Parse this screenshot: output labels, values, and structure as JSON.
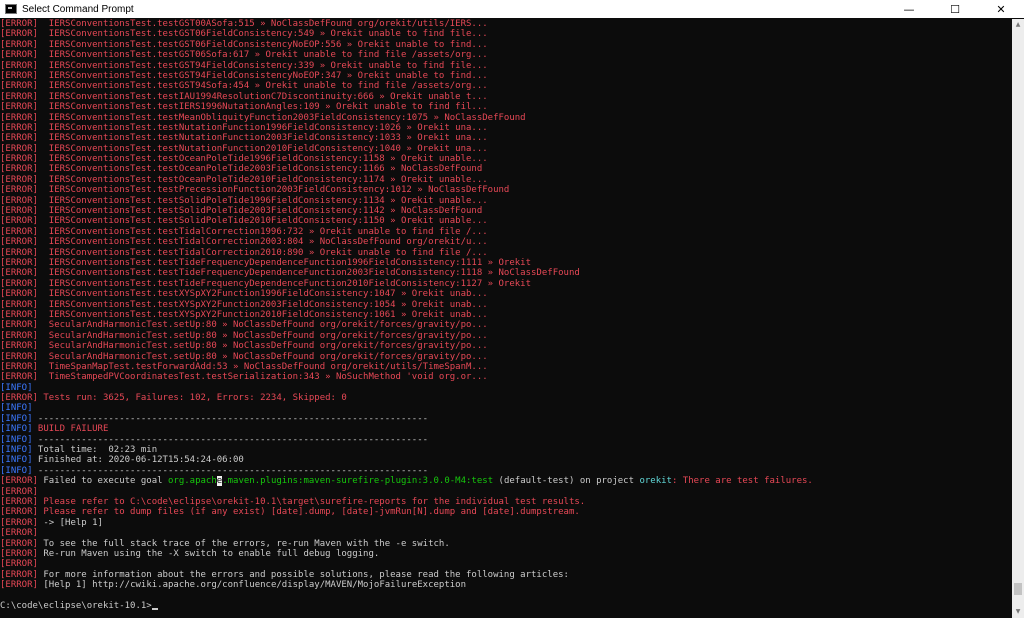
{
  "window": {
    "title": "Select Command Prompt",
    "controls": {
      "minimize": "—",
      "maximize": "☐",
      "close": "✕"
    }
  },
  "colors": {
    "background": "#0c0c0c",
    "error": "#e74856",
    "info": "#3b78ff",
    "green": "#16c60c",
    "cyan": "#61d6d6",
    "text": "#cccccc"
  },
  "terminal": {
    "error_tag": "[ERROR]",
    "info_tag": "[INFO]",
    "test_errors": [
      "  IERSConventionsTest.testGST00ASofa:515 » NoClassDefFound org/orekit/utils/IERS...",
      "  IERSConventionsTest.testGST06FieldConsistency:549 » Orekit unable to find file...",
      "  IERSConventionsTest.testGST06FieldConsistencyNoEOP:556 » Orekit unable to find...",
      "  IERSConventionsTest.testGST06Sofa:617 » Orekit unable to find file /assets/org...",
      "  IERSConventionsTest.testGST94FieldConsistency:339 » Orekit unable to find file...",
      "  IERSConventionsTest.testGST94FieldConsistencyNoEOP:347 » Orekit unable to find...",
      "  IERSConventionsTest.testGST94Sofa:454 » Orekit unable to find file /assets/org...",
      "  IERSConventionsTest.testIAU1994ResolutionC7Discontinuity:666 » Orekit unable t...",
      "  IERSConventionsTest.testIERS1996NutationAngles:109 » Orekit unable to find fil...",
      "  IERSConventionsTest.testMeanObliquityFunction2003FieldConsistency:1075 » NoClassDefFound",
      "  IERSConventionsTest.testNutationFunction1996FieldConsistency:1026 » Orekit una...",
      "  IERSConventionsTest.testNutationFunction2003FieldConsistency:1033 » Orekit una...",
      "  IERSConventionsTest.testNutationFunction2010FieldConsistency:1040 » Orekit una...",
      "  IERSConventionsTest.testOceanPoleTide1996FieldConsistency:1158 » Orekit unable...",
      "  IERSConventionsTest.testOceanPoleTide2003FieldConsistency:1166 » NoClassDefFound",
      "  IERSConventionsTest.testOceanPoleTide2010FieldConsistency:1174 » Orekit unable...",
      "  IERSConventionsTest.testPrecessionFunction2003FieldConsistency:1012 » NoClassDefFound",
      "  IERSConventionsTest.testSolidPoleTide1996FieldConsistency:1134 » Orekit unable...",
      "  IERSConventionsTest.testSolidPoleTide2003FieldConsistency:1142 » NoClassDefFound",
      "  IERSConventionsTest.testSolidPoleTide2010FieldConsistency:1150 » Orekit unable...",
      "  IERSConventionsTest.testTidalCorrection1996:732 » Orekit unable to find file /...",
      "  IERSConventionsTest.testTidalCorrection2003:804 » NoClassDefFound org/orekit/u...",
      "  IERSConventionsTest.testTidalCorrection2010:890 » Orekit unable to find file /...",
      "  IERSConventionsTest.testTideFrequencyDependenceFunction1996FieldConsistency:1111 » Orekit",
      "  IERSConventionsTest.testTideFrequencyDependenceFunction2003FieldConsistency:1118 » NoClassDefFound",
      "  IERSConventionsTest.testTideFrequencyDependenceFunction2010FieldConsistency:1127 » Orekit",
      "  IERSConventionsTest.testXYSpXY2Function1996FieldConsistency:1047 » Orekit unab...",
      "  IERSConventionsTest.testXYSpXY2Function2003FieldConsistency:1054 » Orekit unab...",
      "  IERSConventionsTest.testXYSpXY2Function2010FieldConsistency:1061 » Orekit unab...",
      "  SecularAndHarmonicTest.setUp:80 » NoClassDefFound org/orekit/forces/gravity/po...",
      "  SecularAndHarmonicTest.setUp:80 » NoClassDefFound org/orekit/forces/gravity/po...",
      "  SecularAndHarmonicTest.setUp:80 » NoClassDefFound org/orekit/forces/gravity/po...",
      "  SecularAndHarmonicTest.setUp:80 » NoClassDefFound org/orekit/forces/gravity/po...",
      "  TimeSpanMapTest.testForwardAdd:53 » NoClassDefFound org/orekit/utils/TimeSpanM...",
      "  TimeStampedPVCoordinatesTest.testSerialization:343 » NoSuchMethod 'void org.or..."
    ],
    "tests_run": " Tests run: 3625, Failures: 102, Errors: 2234, Skipped: 0",
    "separator": " ------------------------------------------------------------------------",
    "build_failure": " BUILD FAILURE",
    "total_time": " Total time:  02:23 min",
    "finished_at": " Finished at: 2020-06-12T15:54:24-06:00",
    "failed_pre": " Failed to execute goal ",
    "goal_a": "org.apach",
    "goal_sel": "e",
    "goal_b": ".maven.plugins:maven-surefire-plugin:3.0.0-M4:test",
    "goal_exec": " (default-test)",
    "on_project": " on project ",
    "project": "orekit",
    "failure_msg": ": There are test failures.",
    "refer_1": " Please refer to C:\\code\\eclipse\\orekit-10.1\\target\\surefire-reports for the individual test results.",
    "refer_2": " Please refer to dump files (if any exist) [date].dump, [date]-jvmRun[N].dump and [date].dumpstream.",
    "help_arrow": " -> [Help 1]",
    "stack_trace": " To see the full stack trace of the errors, re-run Maven with the -e switch.",
    "debug_logging": " Re-run Maven using the -X switch to enable full debug logging.",
    "more_info": " For more information about the errors and possible solutions, please read the following articles:",
    "help_1_label": " [Help 1]",
    "help_1_url": " http://cwiki.apache.org/confluence/display/MAVEN/MojoFailureException",
    "prompt": "C:\\code\\eclipse\\orekit-10.1>"
  },
  "scrollbar": {
    "up": "▲",
    "down": "▼",
    "position": 0.98
  }
}
